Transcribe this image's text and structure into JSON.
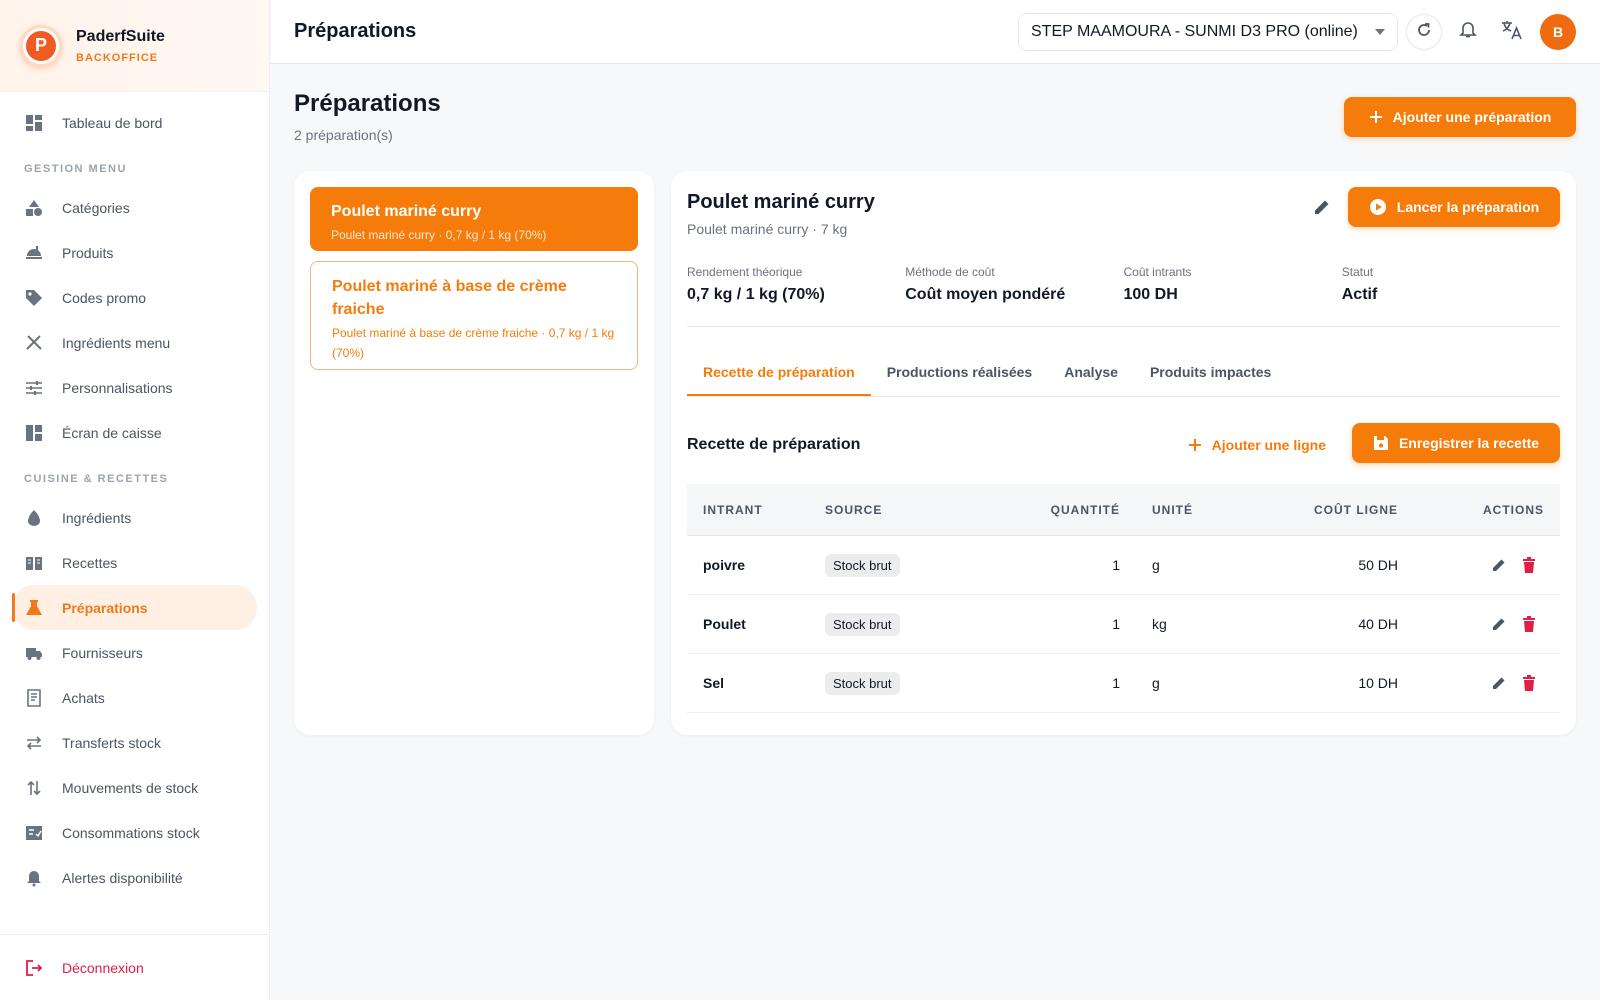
{
  "brand": {
    "name": "PaderfSuite",
    "sub": "BACKOFFICE"
  },
  "sidebar": {
    "items_top": [
      {
        "label": "Tableau de bord",
        "icon": "dashboard-icon"
      }
    ],
    "section_menu": "GESTION MENU",
    "items_menu": [
      {
        "label": "Catégories",
        "icon": "category-icon"
      },
      {
        "label": "Produits",
        "icon": "product-icon"
      },
      {
        "label": "Codes promo",
        "icon": "tag-icon"
      },
      {
        "label": "Ingrédients menu",
        "icon": "utensils-icon"
      },
      {
        "label": "Personnalisations",
        "icon": "tune-icon"
      },
      {
        "label": "Écran de caisse",
        "icon": "layout-icon"
      }
    ],
    "section_cuisine": "CUISINE & RECETTES",
    "items_cuisine": [
      {
        "label": "Ingrédients",
        "icon": "egg-icon"
      },
      {
        "label": "Recettes",
        "icon": "book-icon"
      },
      {
        "label": "Préparations",
        "icon": "flask-icon",
        "active": true
      },
      {
        "label": "Fournisseurs",
        "icon": "truck-icon"
      },
      {
        "label": "Achats",
        "icon": "receipt-icon"
      },
      {
        "label": "Transferts stock",
        "icon": "transfer-icon"
      },
      {
        "label": "Mouvements de stock",
        "icon": "swap-vertical-icon"
      },
      {
        "label": "Consommations stock",
        "icon": "checklist-icon"
      },
      {
        "label": "Alertes disponibilité",
        "icon": "alarm-icon"
      }
    ],
    "logout": "Déconnexion"
  },
  "header": {
    "title": "Préparations",
    "device": "STEP MAAMOURA - SUNMI D3 PRO (online)",
    "avatar": "B"
  },
  "page": {
    "title": "Préparations",
    "count": "2 préparation(s)",
    "add_button": "Ajouter une préparation"
  },
  "preparations": [
    {
      "name": "Poulet mariné curry",
      "meta": "Poulet mariné curry · 0,7 kg / 1 kg (70%)"
    },
    {
      "name": "Poulet mariné à base de crème fraiche",
      "meta": "Poulet mariné à base de crème fraiche · 0,7 kg / 1 kg (70%)"
    }
  ],
  "detail": {
    "title": "Poulet mariné curry",
    "subtitle": "Poulet mariné curry · 7 kg",
    "launch_button": "Lancer la préparation",
    "stats": [
      {
        "label": "Rendement théorique",
        "value": "0,7 kg / 1 kg (70%)"
      },
      {
        "label": "Méthode de coût",
        "value": "Coût moyen pondéré"
      },
      {
        "label": "Coût intrants",
        "value": "100 DH"
      },
      {
        "label": "Statut",
        "value": "Actif"
      }
    ],
    "tabs": [
      "Recette de préparation",
      "Productions réalisées",
      "Analyse",
      "Produits impactes"
    ],
    "section_title": "Recette de préparation",
    "add_line": "Ajouter une ligne",
    "save_button": "Enregistrer la recette",
    "table": {
      "headers": [
        "INTRANT",
        "SOURCE",
        "QUANTITÉ",
        "UNITÉ",
        "COÛT LIGNE",
        "ACTIONS"
      ],
      "rows": [
        {
          "intrant": "poivre",
          "source": "Stock brut",
          "qty": "1",
          "unit": "g",
          "cost": "50 DH"
        },
        {
          "intrant": "Poulet",
          "source": "Stock brut",
          "qty": "1",
          "unit": "kg",
          "cost": "40 DH"
        },
        {
          "intrant": "Sel",
          "source": "Stock brut",
          "qty": "1",
          "unit": "g",
          "cost": "10 DH"
        }
      ]
    }
  },
  "colors": {
    "accent": "#f57c0a",
    "danger": "#e11d48"
  }
}
